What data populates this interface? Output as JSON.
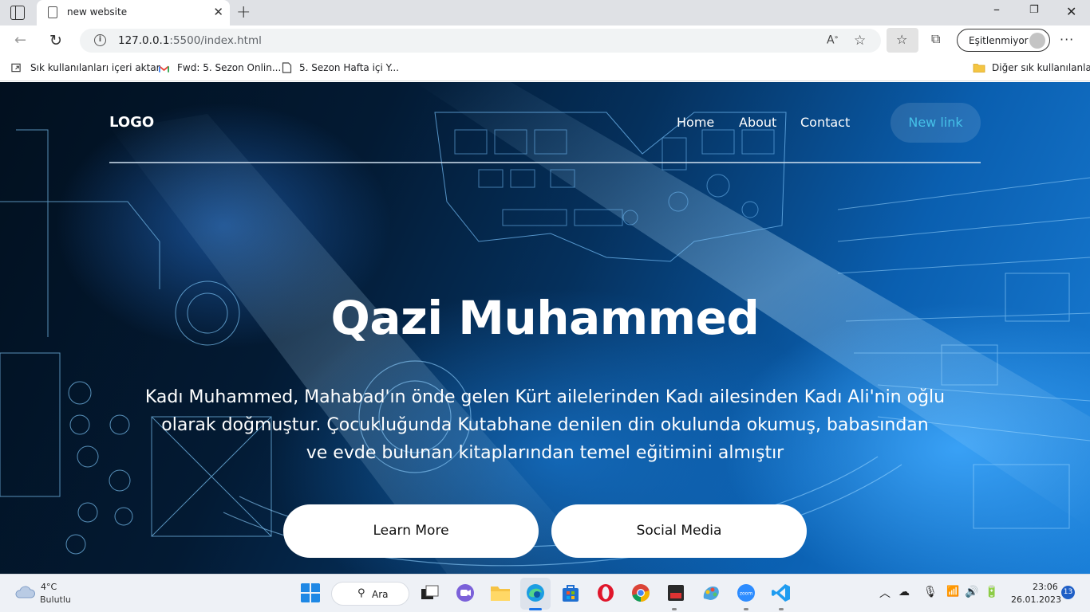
{
  "browser": {
    "tab_title": "new website",
    "url_host": "127.0.0.1",
    "url_rest": ":5500/index.html",
    "sync_label": "Eşitlenmiyor",
    "bookmarks": [
      "Sık kullanılanları içeri aktar",
      "Fwd: 5. Sezon Onlin...",
      "5. Sezon Hafta içi Y..."
    ],
    "other_bookmarks": "Diğer sık kullanılanlar"
  },
  "site": {
    "logo": "LOGO",
    "nav": [
      "Home",
      "About",
      "Contact"
    ],
    "new_link": "New link",
    "hero_title": "Qazi Muhammed",
    "hero_lines": [
      "Kadı Muhammed, Mahabad'ın önde gelen Kürt ailelerinden Kadı ailesinden Kadı Ali'nin oğlu",
      "olarak doğmuştur. Çocukluğunda Kutabhane denilen din okulunda okumuş, babasından",
      "ve evde bulunan kitaplarından temel eğitimini almıştır"
    ],
    "buttons": {
      "learn_more": "Learn More",
      "social_media": "Social Media"
    },
    "accent_color": "#45c1e8"
  },
  "taskbar": {
    "weather_temp": "4°C",
    "weather_desc": "Bulutlu",
    "search_label": "Ara",
    "time": "23:06",
    "date": "26.01.2023",
    "notifications": "13",
    "apps": [
      "start-icon",
      "search-icon",
      "task-view-icon",
      "teams-chat-icon",
      "file-explorer-icon",
      "edge-icon",
      "store-icon",
      "opera-icon",
      "chrome-icon",
      "app-icon",
      "paint-icon",
      "zoom-icon",
      "vscode-icon"
    ]
  }
}
